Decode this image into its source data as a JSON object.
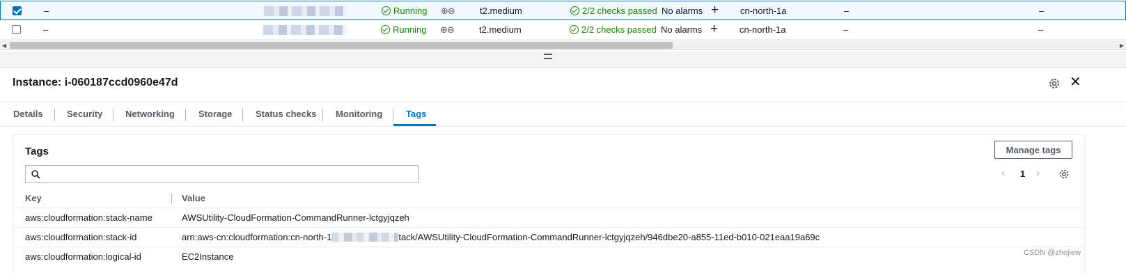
{
  "instances": [
    {
      "selected": true,
      "name": "–",
      "state": "Running",
      "type": "t2.medium",
      "checks": "2/2 checks passed",
      "alarms": "No alarms",
      "az": "cn-north-1a",
      "col1": "–",
      "col2": "–"
    },
    {
      "selected": false,
      "name": "–",
      "state": "Running",
      "type": "t2.medium",
      "checks": "2/2 checks passed",
      "alarms": "No alarms",
      "az": "cn-north-1a",
      "col1": "–",
      "col2": "–"
    }
  ],
  "zoom_glyph": "⊕⊖",
  "plus_glyph": "+",
  "details": {
    "title": "Instance: i-060187ccd0960e47d",
    "close_glyph": "✕"
  },
  "tabs": [
    "Details",
    "Security",
    "Networking",
    "Storage",
    "Status checks",
    "Monitoring",
    "Tags"
  ],
  "active_tab": "Tags",
  "tags_panel": {
    "title": "Tags",
    "manage_label": "Manage tags",
    "search_placeholder": "",
    "page": "1",
    "prev_glyph": "‹",
    "next_glyph": "›",
    "col_key": "Key",
    "col_value": "Value",
    "rows": [
      {
        "key": "aws:cloudformation:stack-name",
        "value": "AWSUtility-CloudFormation-CommandRunner-lctgyjqzeh"
      },
      {
        "key": "aws:cloudformation:stack-id",
        "value_prefix": "arn:aws-cn:cloudformation:cn-north-1",
        "value_suffix": "tack/AWSUtility-CloudFormation-CommandRunner-lctgyjqzeh/946dbe20-a855-11ed-b010-021eaa19a69c"
      },
      {
        "key": "aws:cloudformation:logical-id",
        "value": "EC2Instance"
      }
    ]
  },
  "watermark": "CSDN @zhojiew",
  "colors": {
    "accent": "#0073bb",
    "success": "#1d8102",
    "text": "#16191f",
    "muted": "#545b64"
  },
  "icons": [
    "checkbox-icon",
    "status-ok-icon",
    "zoom-in-icon",
    "zoom-out-icon",
    "plus-icon",
    "drag-handle-icon",
    "gear-icon",
    "close-icon",
    "search-icon",
    "chevron-left-icon",
    "chevron-right-icon"
  ]
}
